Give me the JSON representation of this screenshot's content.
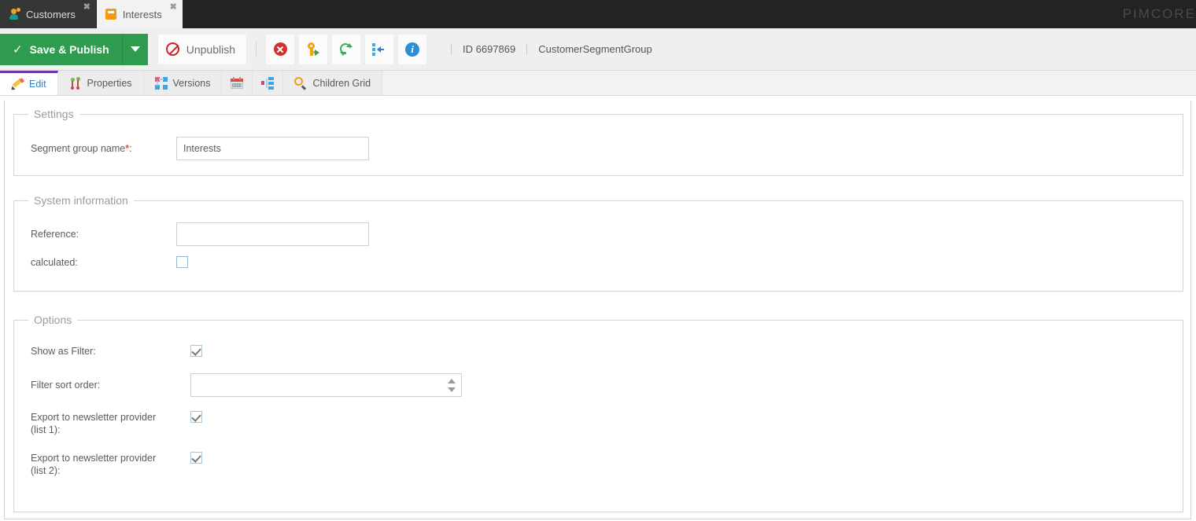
{
  "window": {
    "brand": "PIMCORE"
  },
  "document_tabs": [
    {
      "label": "Customers",
      "icon": "customer-person-icon",
      "active": false
    },
    {
      "label": "Interests",
      "icon": "object-orange-icon",
      "active": true
    }
  ],
  "toolbar": {
    "save_label": "Save & Publish",
    "save_check_glyph": "✓",
    "save_menu_icon": "chevron-down-icon",
    "unpublish_label": "Unpublish",
    "unpublish_icon": "ban-icon",
    "icon_buttons": [
      {
        "name": "delete-button",
        "icon": "delete-circle-icon"
      },
      {
        "name": "permissions-button",
        "icon": "key-icon"
      },
      {
        "name": "reload-button",
        "icon": "reload-icon"
      },
      {
        "name": "locate-in-tree-button",
        "icon": "tree-locate-icon"
      },
      {
        "name": "info-button",
        "icon": "info-circle-icon"
      }
    ],
    "object_id": "ID 6697869",
    "class_name": "CustomerSegmentGroup"
  },
  "subtabs": [
    {
      "label": "Edit",
      "icon": "pencil-icon",
      "active": true
    },
    {
      "label": "Properties",
      "icon": "properties-pins-icon",
      "active": false
    },
    {
      "label": "Versions",
      "icon": "versions-nodes-icon",
      "active": false
    },
    {
      "label": "",
      "icon": "calendar-icon",
      "active": false
    },
    {
      "label": "",
      "icon": "relations-icon",
      "active": false
    },
    {
      "label": "Children Grid",
      "icon": "search-magnifier-icon",
      "active": false
    }
  ],
  "form": {
    "settings": {
      "legend": "Settings",
      "segment_group_name": {
        "label": "Segment group name",
        "required_marker": "*",
        "colon": ":",
        "value": "Interests"
      }
    },
    "system_information": {
      "legend": "System information",
      "reference": {
        "label": "Reference:",
        "value": ""
      },
      "calculated": {
        "label": "calculated:",
        "checked": false
      }
    },
    "options": {
      "legend": "Options",
      "show_as_filter": {
        "label": "Show as Filter:",
        "checked": true
      },
      "filter_sort_order": {
        "label": "Filter sort order:",
        "value": ""
      },
      "export_list_1": {
        "label_line1": "Export to newsletter provider",
        "label_line2": "(list 1):",
        "checked": true
      },
      "export_list_2": {
        "label_line1": "Export to newsletter provider",
        "label_line2": "(list 2):",
        "checked": true
      }
    }
  },
  "colors": {
    "save_green": "#2e9b4f",
    "active_tab_purple": "#6f33a5",
    "link_blue": "#3b7fc4",
    "required_red": "#e2534c",
    "object_orange": "#f59a12"
  }
}
